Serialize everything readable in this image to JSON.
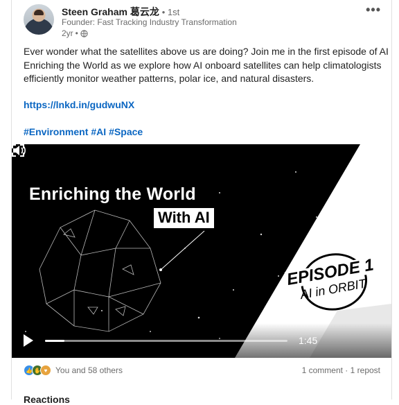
{
  "author": {
    "name": "Steen Graham 葛云龙",
    "degree": "1st",
    "headline": "Founder: Fast Tracking Industry Transformation",
    "time_ago": "2yr"
  },
  "post": {
    "text": "Ever wonder what the satellites above us are doing? Join me in the first episode of AI Enriching the World as we explore how AI onboard satellites can help climatologists efficiently monitor weather patterns, polar ice, and natural disasters.",
    "link": "https://lnkd.in/gudwuNX",
    "hashtags": [
      "#Environment",
      "#AI",
      "#Space"
    ]
  },
  "video": {
    "title": "Enriching the World",
    "subtitle": "With AI",
    "episode_label": "EPISODE 1",
    "episode_sub": "AI in ORBIT",
    "duration": "1:45",
    "progress": 0.08
  },
  "social": {
    "reactions_text": "You and 58 others",
    "comments": "1 comment",
    "reposts": "1 repost",
    "reactions_heading": "Reactions"
  },
  "icons": [
    "more-options-icon",
    "globe-icon",
    "play-icon",
    "volume-icon",
    "fullscreen-icon",
    "like-reaction-icon",
    "celebrate-reaction-icon",
    "support-reaction-icon"
  ]
}
